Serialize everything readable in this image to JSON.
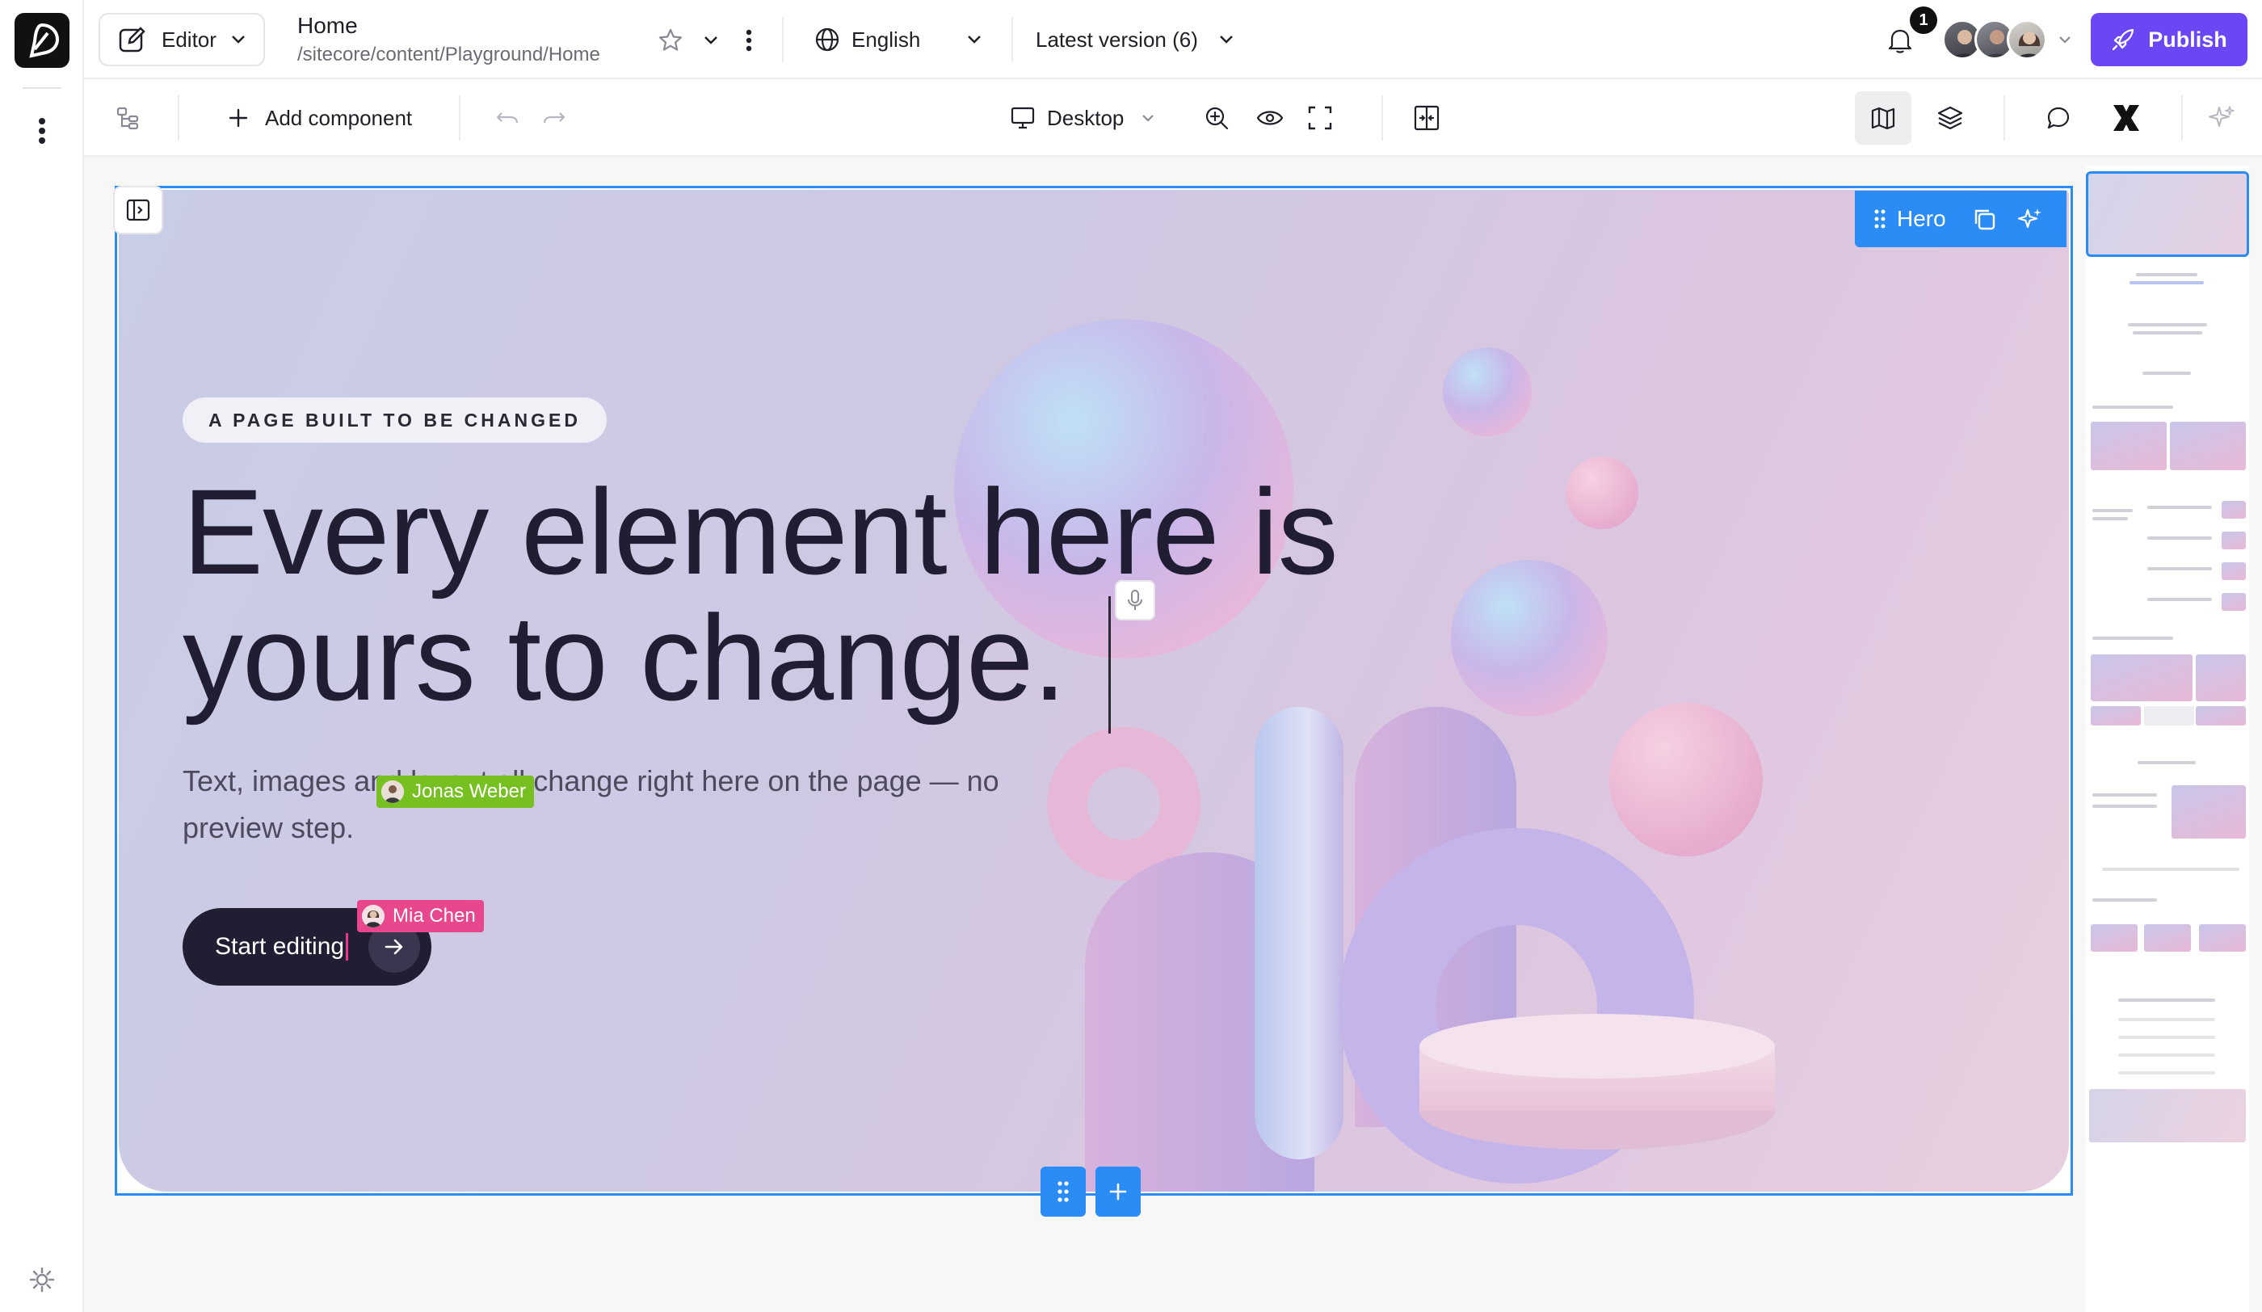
{
  "app": {
    "mode_label": "Editor",
    "page_title": "Home",
    "page_path": "/sitecore/content/Playground/Home",
    "language": "English",
    "version": "Latest version (6)",
    "notification_count": "1",
    "publish_label": "Publish",
    "accent_color": "#6b46f5",
    "selection_color": "#2b8cf5"
  },
  "toolbar": {
    "add_component_label": "Add component",
    "device_label": "Desktop",
    "icons": [
      "tree-icon",
      "plus-icon",
      "undo-icon",
      "redo-icon",
      "monitor-icon",
      "zoom-icon",
      "eye-icon",
      "fullscreen-icon",
      "compare-icon",
      "map-icon",
      "layers-icon",
      "comment-icon",
      "brand-icon",
      "sparkle-icon"
    ]
  },
  "hero": {
    "component_label": "Hero",
    "eyebrow": "A PAGE BUILT TO BE CHANGED",
    "headline_line1": "Every element here is",
    "headline_line2": "yours to change.",
    "subtext": "Text, images and layout all change right here on the page — no preview step.",
    "cta_label": "Start editing"
  },
  "presence": [
    {
      "name": "Jonas Weber",
      "color": "#76c021"
    },
    {
      "name": "Mia Chen",
      "color": "#e8468d"
    }
  ]
}
